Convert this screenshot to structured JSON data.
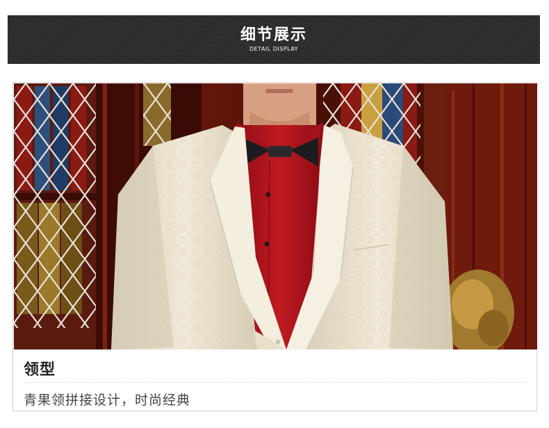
{
  "header": {
    "title": "细节展示",
    "subtitle": "DETAIL DISPLAY"
  },
  "detail": {
    "title": "领型",
    "description": "青果领拼接设计，时尚经典"
  },
  "colors": {
    "header_bg": "#2b2929",
    "jacket": "#ece4d0",
    "shirt": "#b2141c",
    "wood": "#5a1208"
  }
}
